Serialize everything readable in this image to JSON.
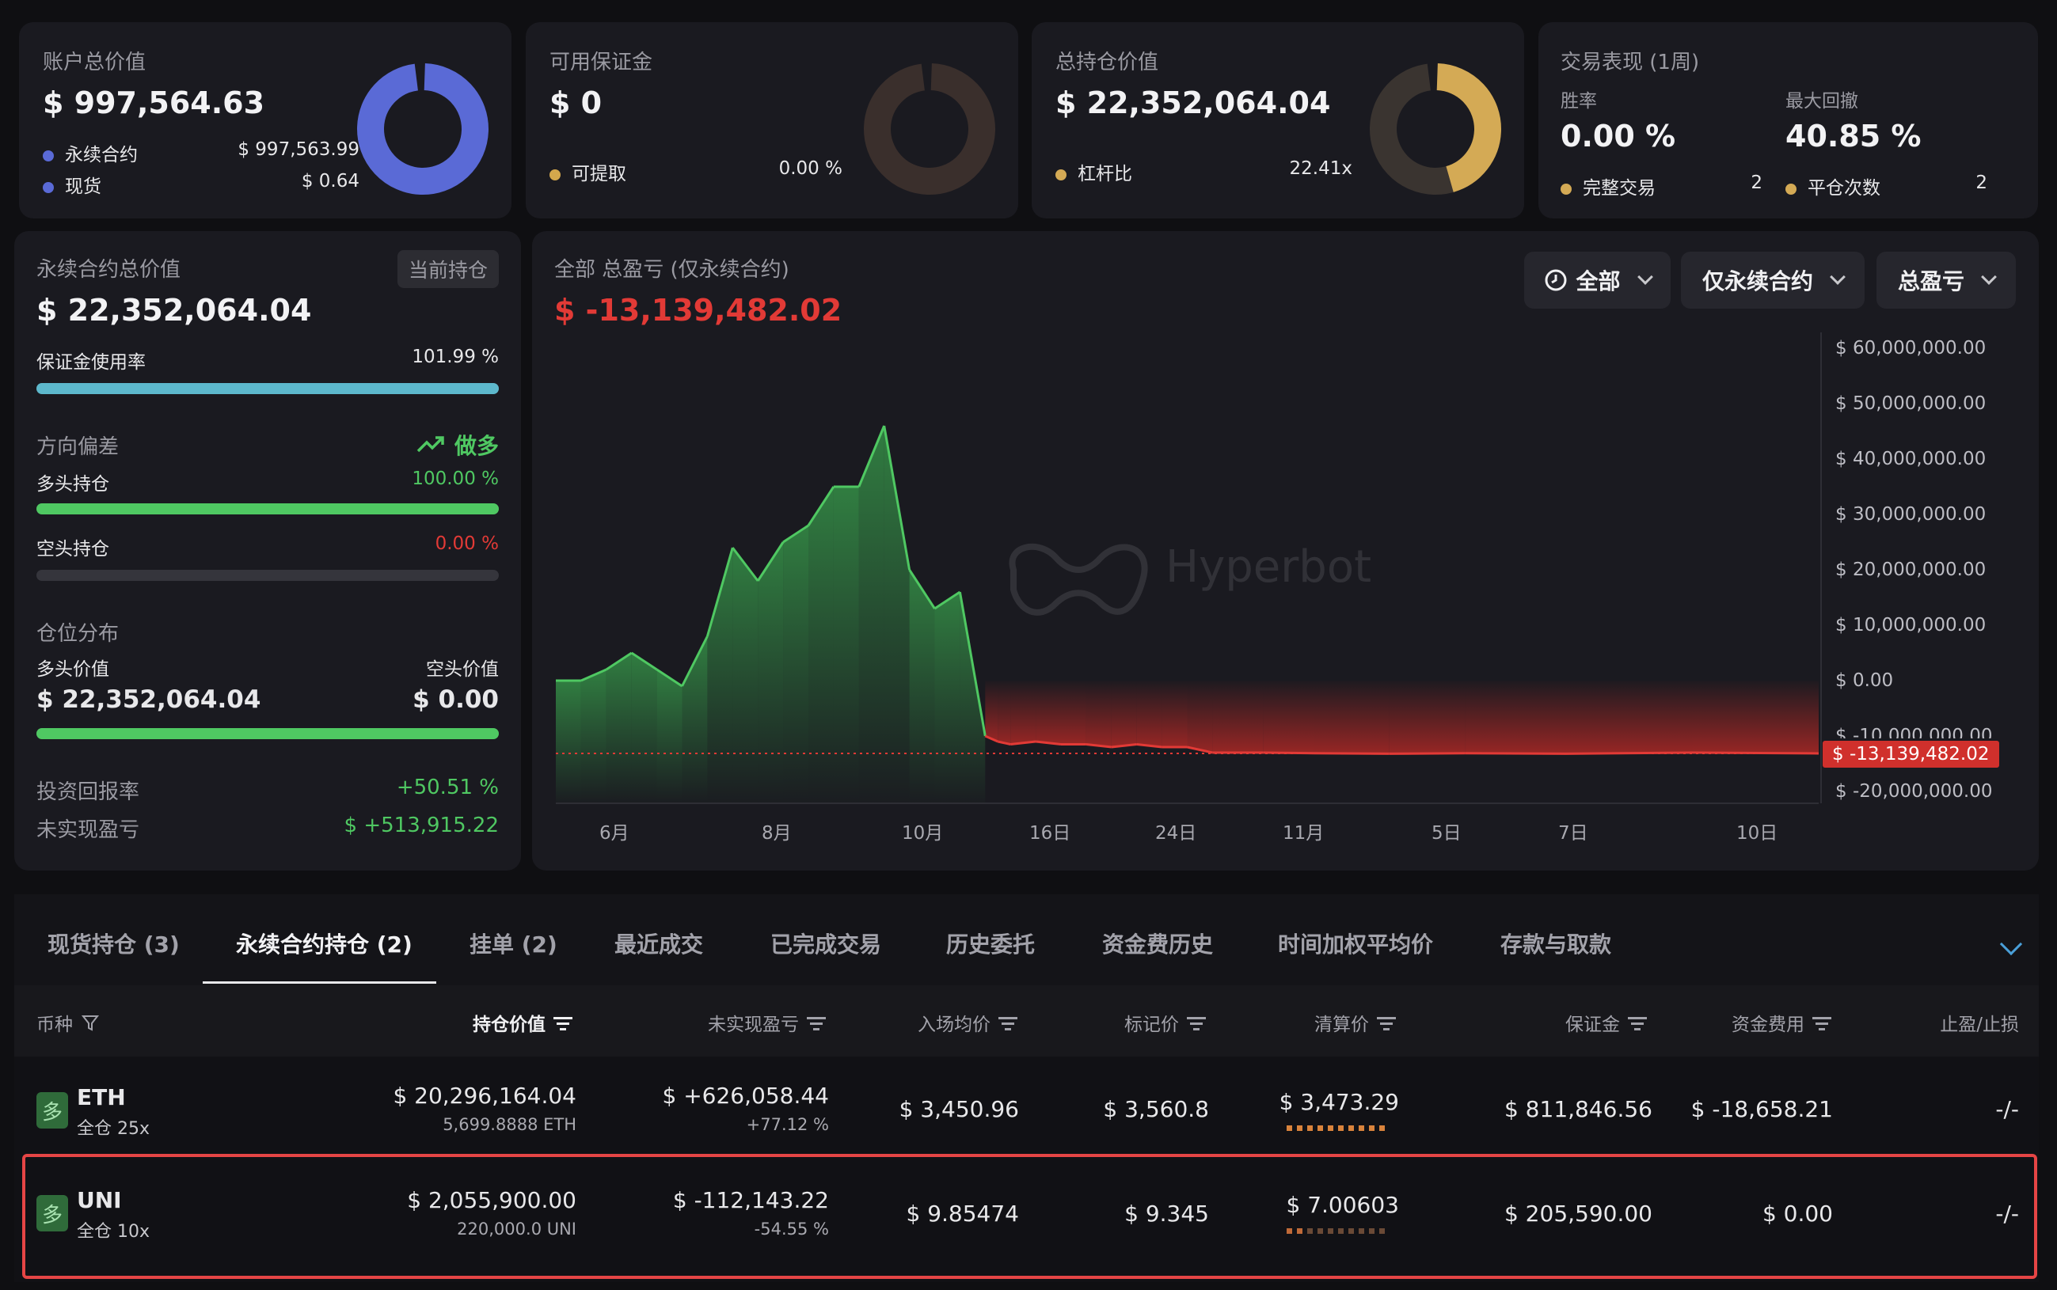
{
  "summary": {
    "account": {
      "label": "账户总价值",
      "value": "$ 997,564.63",
      "rows": [
        {
          "name": "永续合约",
          "value": "$ 997,563.99"
        },
        {
          "name": "现货",
          "value": "$ 0.64"
        }
      ],
      "color": "#5a6ad6"
    },
    "margin": {
      "label": "可用保证金",
      "value": "$ 0",
      "row": {
        "name": "可提取",
        "value": "0.00 %"
      },
      "color": "#d4a84c"
    },
    "position": {
      "label": "总持仓价值",
      "value": "$ 22,352,064.04",
      "row": {
        "name": "杠杆比",
        "value": "22.41x"
      },
      "color": "#d4aa55",
      "fill_fraction": 0.45
    },
    "trading": {
      "label": "交易表现 (1周)",
      "win_label": "胜率",
      "win_value": "0.00 %",
      "dd_label": "最大回撤",
      "dd_value": "40.85 %",
      "rows": [
        {
          "name": "完整交易",
          "value": "2"
        },
        {
          "name": "平仓次数",
          "value": "2"
        }
      ]
    }
  },
  "perp": {
    "label": "永续合约总价值",
    "tag": "当前持仓",
    "value": "$ 22,352,064.04",
    "margin_usage_label": "保证金使用率",
    "margin_usage_value": "101.99 %",
    "margin_usage_fraction": 1.0,
    "bias_label": "方向偏差",
    "bias_value": "做多",
    "long_label": "多头持仓",
    "long_value": "100.00 %",
    "long_fraction": 1.0,
    "short_label": "空头持仓",
    "short_value": "0.00 %",
    "short_fraction": 0.0,
    "dist_label": "仓位分布",
    "long_val_label": "多头价值",
    "short_val_label": "空头价值",
    "long_val": "$ 22,352,064.04",
    "short_val": "$ 0.00",
    "roi_label": "投资回报率",
    "roi_value": "+50.51 %",
    "upnl_label": "未实现盈亏",
    "upnl_value": "$ +513,915.22"
  },
  "pnl_chart": {
    "title": "全部 总盈亏 (仅永续合约)",
    "value": "$ -13,139,482.02",
    "filters": [
      "全部",
      "仅永续合约",
      "总盈亏"
    ],
    "watermark": "Hyperbot"
  },
  "chart_data": {
    "type": "area",
    "title": "全部 总盈亏 (仅永续合约)",
    "y_ticks": [
      "$ 60,000,000.00",
      "$ 50,000,000.00",
      "$ 40,000,000.00",
      "$ 30,000,000.00",
      "$ 20,000,000.00",
      "$ 10,000,000.00",
      "$ 0.00",
      "$ -10,000,000.00",
      "$ -20,000,000.00"
    ],
    "x_ticks": [
      "6月",
      "8月",
      "10月",
      "16日",
      "24日",
      "11月",
      "5日",
      "7日",
      "10日"
    ],
    "ylim": [
      -20000000,
      60000000
    ],
    "current_label": "$ -13,139,482.02",
    "current_value": -13139482.02,
    "x": [
      0,
      2,
      4,
      6,
      8,
      10,
      12,
      14,
      16,
      18,
      20,
      22,
      24,
      26,
      28,
      30,
      32,
      34,
      35,
      36,
      38,
      40,
      42,
      44,
      46,
      48,
      50,
      52,
      56,
      60,
      66,
      72,
      80,
      90,
      100
    ],
    "values": [
      0,
      0,
      2000000,
      5000000,
      2000000,
      -1000000,
      8000000,
      24000000,
      18000000,
      25000000,
      28000000,
      35000000,
      35000000,
      46000000,
      20000000,
      13000000,
      16000000,
      -10000000,
      -11000000,
      -11500000,
      -11000000,
      -11500000,
      -11500000,
      -12000000,
      -11500000,
      -12000000,
      -12000000,
      -13000000,
      -13000000,
      -13100000,
      -13200000,
      -13100000,
      -13200000,
      -13000000,
      -13139482.02
    ]
  },
  "tabs": [
    "现货持仓 (3)",
    "永续合约持仓 (2)",
    "挂单 (2)",
    "最近成交",
    "已完成交易",
    "历史委托",
    "资金费历史",
    "时间加权平均价",
    "存款与取款"
  ],
  "columns": [
    "币种",
    "持仓价值",
    "未实现盈亏",
    "入场均价",
    "标记价",
    "清算价",
    "保证金",
    "资金费用",
    "止盈/止损"
  ],
  "rows": [
    {
      "badge": "多",
      "coin": "ETH",
      "mode": "全仓 25x",
      "value": "$ 20,296,164.04",
      "size": "5,699.8888 ETH",
      "upnl": "$ +626,058.44",
      "upnl_pct": "+77.12 %",
      "entry": "$ 3,450.96",
      "mark": "$ 3,560.8",
      "liq": "$ 3,473.29",
      "margin": "$ 811,846.56",
      "funding": "$ -18,658.21",
      "tpsl": "-/-"
    },
    {
      "badge": "多",
      "coin": "UNI",
      "mode": "全仓 10x",
      "value": "$ 2,055,900.00",
      "size": "220,000.0 UNI",
      "upnl": "$ -112,143.22",
      "upnl_pct": "-54.55 %",
      "entry": "$ 9.85474",
      "mark": "$ 9.345",
      "liq": "$ 7.00603",
      "margin": "$ 205,590.00",
      "funding": "$ 0.00",
      "tpsl": "-/-"
    }
  ]
}
